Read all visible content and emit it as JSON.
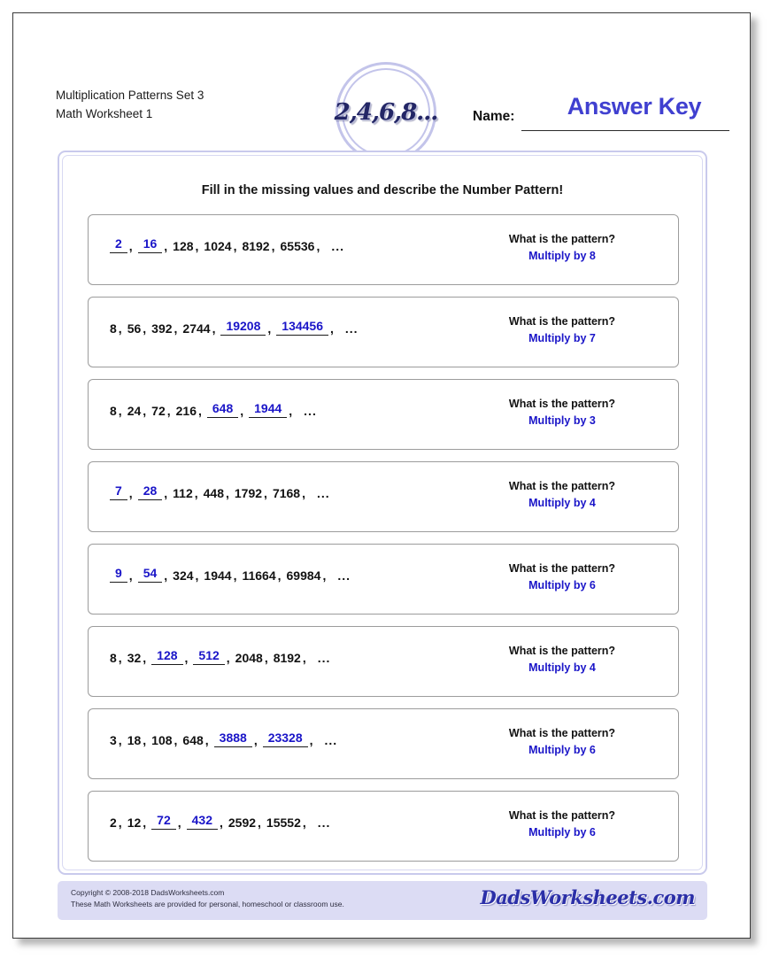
{
  "header": {
    "worksheet_title": "Multiplication Patterns Set 3",
    "worksheet_subtitle": "Math Worksheet 1",
    "logo_text": "2,4,6,8...",
    "name_label": "Name:",
    "name_value": "Answer Key",
    "answer_key_color": "#4040d0"
  },
  "instructions": "Fill in the missing values and describe the Number Pattern!",
  "pattern_question": "What is the pattern?",
  "ellipsis": "...",
  "problems": [
    {
      "terms": [
        {
          "value": "2",
          "answer": true
        },
        {
          "value": "16",
          "answer": true
        },
        {
          "value": "128",
          "answer": false
        },
        {
          "value": "1024",
          "answer": false
        },
        {
          "value": "8192",
          "answer": false
        },
        {
          "value": "65536",
          "answer": false
        }
      ],
      "question": "What is the pattern?",
      "answer": "Multiply by 8"
    },
    {
      "terms": [
        {
          "value": "8",
          "answer": false
        },
        {
          "value": "56",
          "answer": false
        },
        {
          "value": "392",
          "answer": false
        },
        {
          "value": "2744",
          "answer": false
        },
        {
          "value": "19208",
          "answer": true
        },
        {
          "value": "134456",
          "answer": true
        }
      ],
      "question": "What is the pattern?",
      "answer": "Multiply by 7"
    },
    {
      "terms": [
        {
          "value": "8",
          "answer": false
        },
        {
          "value": "24",
          "answer": false
        },
        {
          "value": "72",
          "answer": false
        },
        {
          "value": "216",
          "answer": false
        },
        {
          "value": "648",
          "answer": true
        },
        {
          "value": "1944",
          "answer": true
        }
      ],
      "question": "What is the pattern?",
      "answer": "Multiply by 3"
    },
    {
      "terms": [
        {
          "value": "7",
          "answer": true
        },
        {
          "value": "28",
          "answer": true
        },
        {
          "value": "112",
          "answer": false
        },
        {
          "value": "448",
          "answer": false
        },
        {
          "value": "1792",
          "answer": false
        },
        {
          "value": "7168",
          "answer": false
        }
      ],
      "question": "What is the pattern?",
      "answer": "Multiply by 4"
    },
    {
      "terms": [
        {
          "value": "9",
          "answer": true
        },
        {
          "value": "54",
          "answer": true
        },
        {
          "value": "324",
          "answer": false
        },
        {
          "value": "1944",
          "answer": false
        },
        {
          "value": "11664",
          "answer": false
        },
        {
          "value": "69984",
          "answer": false
        }
      ],
      "question": "What is the pattern?",
      "answer": "Multiply by 6"
    },
    {
      "terms": [
        {
          "value": "8",
          "answer": false
        },
        {
          "value": "32",
          "answer": false
        },
        {
          "value": "128",
          "answer": true
        },
        {
          "value": "512",
          "answer": true
        },
        {
          "value": "2048",
          "answer": false
        },
        {
          "value": "8192",
          "answer": false
        }
      ],
      "question": "What is the pattern?",
      "answer": "Multiply by 4"
    },
    {
      "terms": [
        {
          "value": "3",
          "answer": false
        },
        {
          "value": "18",
          "answer": false
        },
        {
          "value": "108",
          "answer": false
        },
        {
          "value": "648",
          "answer": false
        },
        {
          "value": "3888",
          "answer": true
        },
        {
          "value": "23328",
          "answer": true
        }
      ],
      "question": "What is the pattern?",
      "answer": "Multiply by 6"
    },
    {
      "terms": [
        {
          "value": "2",
          "answer": false
        },
        {
          "value": "12",
          "answer": false
        },
        {
          "value": "72",
          "answer": true
        },
        {
          "value": "432",
          "answer": true
        },
        {
          "value": "2592",
          "answer": false
        },
        {
          "value": "15552",
          "answer": false
        }
      ],
      "question": "What is the pattern?",
      "answer": "Multiply by 6"
    }
  ],
  "footer": {
    "copyright_line1": "Copyright © 2008-2018 DadsWorksheets.com",
    "copyright_line2": "These Math Worksheets are provided for personal, homeschool or classroom use.",
    "logo_text": "DadsWorksheets.com"
  }
}
